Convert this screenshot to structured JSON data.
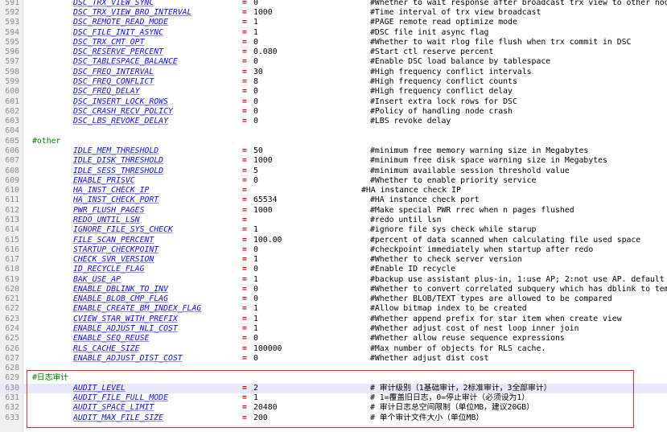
{
  "editor": {
    "lines": [
      {
        "num": "591",
        "type": "kv",
        "key": "DSC_TRX_VIEW_SYNC",
        "eq": "=",
        "val": "0",
        "cmt": "#Whether to wait response after broadcast trx view to other nodes"
      },
      {
        "num": "592",
        "type": "kv",
        "key": "DSC_TRX_VIEW_BRO_INTERVAL",
        "eq": "=",
        "val": "1000",
        "cmt": "#Time interval of trx view broadcast"
      },
      {
        "num": "593",
        "type": "kv",
        "key": "DSC_REMOTE_READ_MODE",
        "eq": "=",
        "val": "1",
        "cmt": "#PAGE remote read optimize mode"
      },
      {
        "num": "594",
        "type": "kv",
        "key": "DSC_FILE_INIT_ASYNC",
        "eq": "=",
        "val": "1",
        "cmt": "#DSC file init async flag"
      },
      {
        "num": "595",
        "type": "kv",
        "key": "DSC_TRX_CMT_OPT",
        "eq": "=",
        "val": "0",
        "cmt": "#Whether to wait rlog file flush when trx commit in DSC"
      },
      {
        "num": "596",
        "type": "kv",
        "key": "DSC_RESERVE_PERCENT",
        "eq": "=",
        "val": "0.080",
        "cmt": "#Start ctl reserve percent"
      },
      {
        "num": "597",
        "type": "kv",
        "key": "DSC_TABLESPACE_BALANCE",
        "eq": "=",
        "val": "0",
        "cmt": "#Enable DSC load balance by tablespace"
      },
      {
        "num": "598",
        "type": "kv",
        "key": "DSC_FREQ_INTERVAL",
        "eq": "=",
        "val": "30",
        "cmt": "#High frequency conflict intervals"
      },
      {
        "num": "599",
        "type": "kv",
        "key": "DSC_FREQ_CONFLICT",
        "eq": "=",
        "val": "8",
        "cmt": "#High frequency conflict counts"
      },
      {
        "num": "600",
        "type": "kv",
        "key": "DSC_FREQ_DELAY",
        "eq": "=",
        "val": "0",
        "cmt": "#High frequency conflict delay"
      },
      {
        "num": "601",
        "type": "kv",
        "key": "DSC_INSERT_LOCK_ROWS",
        "eq": "=",
        "val": "0",
        "cmt": "#Insert extra lock rows for DSC"
      },
      {
        "num": "602",
        "type": "kv",
        "key": "DSC_CRASH_RECV_POLICY",
        "eq": "=",
        "val": "0",
        "cmt": "#Policy of handling node crash"
      },
      {
        "num": "603",
        "type": "kv",
        "key": "DSC_LBS_REVOKE_DELAY",
        "eq": "=",
        "val": "0",
        "cmt": "#LBS revoke delay"
      },
      {
        "num": "604",
        "type": "blank"
      },
      {
        "num": "605",
        "type": "section",
        "text": "#other"
      },
      {
        "num": "606",
        "type": "kv",
        "key": "IDLE_MEM_THRESHOLD",
        "eq": "=",
        "val": "50",
        "cmt": "#minimum free memory warning size in Megabytes"
      },
      {
        "num": "607",
        "type": "kv",
        "key": "IDLE_DISK_THRESHOLD",
        "eq": "=",
        "val": "1000",
        "cmt": "#minimum free disk space warning size in Megabytes"
      },
      {
        "num": "608",
        "type": "kv",
        "key": "IDLE_SESS_THRESHOLD",
        "eq": "=",
        "val": "5",
        "cmt": "#minimum available session threshold value"
      },
      {
        "num": "609",
        "type": "kv",
        "key": "ENABLE_PRISVC",
        "eq": "=",
        "val": "0",
        "cmt": "#Whether to enable priority service"
      },
      {
        "num": "610",
        "type": "kv",
        "key": "HA_INST_CHECK_IP",
        "eq": "=",
        "val": "",
        "cmt": "#HA instance check IP",
        "shift": true
      },
      {
        "num": "611",
        "type": "kv",
        "key": "HA_INST_CHECK_PORT",
        "eq": "=",
        "val": "65534",
        "cmt": "#HA instance check port"
      },
      {
        "num": "612",
        "type": "kv",
        "key": "PWR_FLUSH_PAGES",
        "eq": "=",
        "val": "1000",
        "cmt": "#Make special PWR rrec when n pages flushed"
      },
      {
        "num": "613",
        "type": "kv",
        "key": "REDO_UNTIL_LSN",
        "eq": "=",
        "val": "",
        "cmt": "#redo until lsn"
      },
      {
        "num": "614",
        "type": "kv",
        "key": "IGNORE_FILE_SYS_CHECK",
        "eq": "=",
        "val": "1",
        "cmt": "#ignore file sys check while starup"
      },
      {
        "num": "615",
        "type": "kv",
        "key": "FILE_SCAN_PERCENT",
        "eq": "=",
        "val": "100.00",
        "cmt": "#percent of data scanned when calculating file used space"
      },
      {
        "num": "616",
        "type": "kv",
        "key": "STARTUP_CHECKPOINT",
        "eq": "=",
        "val": "0",
        "cmt": "#checkpoint immediately when startup after redo"
      },
      {
        "num": "617",
        "type": "kv",
        "key": "CHECK_SVR_VERSION",
        "eq": "=",
        "val": "1",
        "cmt": "#Whether to check server version"
      },
      {
        "num": "618",
        "type": "kv",
        "key": "ID_RECYCLE_FLAG",
        "eq": "=",
        "val": "0",
        "cmt": "#Enable ID recycle"
      },
      {
        "num": "619",
        "type": "kv",
        "key": "BAK_USE_AP",
        "eq": "=",
        "val": "1",
        "cmt": "#backup use assistant plus-in, 1:use AP; 2:not use AP. default is 1."
      },
      {
        "num": "620",
        "type": "kv",
        "key": "ENABLE_DBLINK_TO_INV",
        "eq": "=",
        "val": "0",
        "cmt": "#Whether to convert correlated subquery which has dblink to temporary table"
      },
      {
        "num": "621",
        "type": "kv",
        "key": "ENABLE_BLOB_CMP_FLAG",
        "eq": "=",
        "val": "0",
        "cmt": "#Whether BLOB/TEXT types are allowed to be compared"
      },
      {
        "num": "622",
        "type": "kv",
        "key": "ENABLE_CREATE_BM_INDEX_FLAG",
        "eq": "=",
        "val": "1",
        "cmt": "#Allow bitmap index to be created"
      },
      {
        "num": "623",
        "type": "kv",
        "key": "CVIEW_STAR_WITH_PREFIX",
        "eq": "=",
        "val": "1",
        "cmt": "#Whether append prefix for star item when create view"
      },
      {
        "num": "624",
        "type": "kv",
        "key": "ENABLE_ADJUST_NLI_COST",
        "eq": "=",
        "val": "1",
        "cmt": "#Whether adjust cost of nest loop inner join"
      },
      {
        "num": "625",
        "type": "kv",
        "key": "ENABLE_SEQ_REUSE",
        "eq": "=",
        "val": "0",
        "cmt": "#Whether allow reuse sequence expressions"
      },
      {
        "num": "626",
        "type": "kv",
        "key": "RLS_CACHE_SIZE",
        "eq": "=",
        "val": "100000",
        "cmt": "#Max number of objects for RLS cache."
      },
      {
        "num": "627",
        "type": "kv",
        "key": "ENABLE_ADJUST_DIST_COST",
        "eq": "=",
        "val": "0",
        "cmt": "#Whether adjust dist cost"
      },
      {
        "num": "628",
        "type": "blank"
      },
      {
        "num": "629",
        "type": "section",
        "text": "#日志审计"
      },
      {
        "num": "630",
        "type": "kv",
        "key": "AUDIT_LEVEL",
        "eq": "=",
        "val": "2",
        "cmt": "# 审计级别（1基础审计，2标准审计，3全部审计）",
        "highlight": true
      },
      {
        "num": "631",
        "type": "kv",
        "key": "AUDIT_FILE_FULL_MODE",
        "eq": "=",
        "val": "1",
        "cmt": "# 1=覆盖旧日志，0=停止审计（必须设为1）"
      },
      {
        "num": "632",
        "type": "kv",
        "key": "AUDIT_SPACE_LIMIT",
        "eq": "=",
        "val": "20480",
        "cmt": "# 审计日志总空间限制（单位MB，建议20GB）"
      },
      {
        "num": "633",
        "type": "kv",
        "key": "AUDIT_MAX_FILE_SIZE",
        "eq": "=",
        "val": "200",
        "cmt": "# 单个审计文件大小（单位MB）"
      }
    ]
  },
  "colors": {
    "key": "#1010e8",
    "equals": "#c00000",
    "section_comment": "#008000",
    "highlight_line": "#e8e8f8",
    "selection_box": "#e03030"
  }
}
